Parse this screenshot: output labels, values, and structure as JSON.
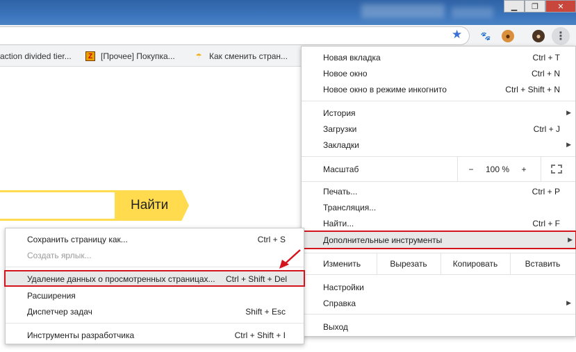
{
  "window": {
    "minimize": "▁",
    "maximize": "❐",
    "close": "✕"
  },
  "bookmarks": [
    {
      "label": "action divided tier..."
    },
    {
      "label": "[Прочее] Покупка...",
      "icon": "z-favicon"
    },
    {
      "label": "Как сменить стран...",
      "icon": "umbrella-favicon"
    }
  ],
  "page": {
    "find_button": "Найти"
  },
  "menu": {
    "new_tab": {
      "label": "Новая вкладка",
      "shortcut": "Ctrl + T"
    },
    "new_window": {
      "label": "Новое окно",
      "shortcut": "Ctrl + N"
    },
    "incognito": {
      "label": "Новое окно в режиме инкогнито",
      "shortcut": "Ctrl + Shift + N"
    },
    "history": {
      "label": "История"
    },
    "downloads": {
      "label": "Загрузки",
      "shortcut": "Ctrl + J"
    },
    "bookmarks": {
      "label": "Закладки"
    },
    "zoom": {
      "label": "Масштаб",
      "minus": "−",
      "value": "100 %",
      "plus": "+"
    },
    "print": {
      "label": "Печать...",
      "shortcut": "Ctrl + P"
    },
    "cast": {
      "label": "Трансляция..."
    },
    "find": {
      "label": "Найти...",
      "shortcut": "Ctrl + F"
    },
    "more_tools": {
      "label": "Дополнительные инструменты"
    },
    "edit": {
      "label": "Изменить",
      "cut": "Вырезать",
      "copy": "Копировать",
      "paste": "Вставить"
    },
    "settings": {
      "label": "Настройки"
    },
    "help": {
      "label": "Справка"
    },
    "exit": {
      "label": "Выход"
    }
  },
  "submenu": {
    "save_page": {
      "label": "Сохранить страницу как...",
      "shortcut": "Ctrl + S"
    },
    "create_shortcut": {
      "label": "Создать ярлык..."
    },
    "clear_data": {
      "label": "Удаление данных о просмотренных страницах...",
      "shortcut": "Ctrl + Shift + Del"
    },
    "extensions": {
      "label": "Расширения"
    },
    "task_manager": {
      "label": "Диспетчер задач",
      "shortcut": "Shift + Esc"
    },
    "dev_tools": {
      "label": "Инструменты разработчика",
      "shortcut": "Ctrl + Shift + I"
    }
  },
  "colors": {
    "highlight_border": "#d3141c",
    "yandex_yellow": "#ffdb4d"
  }
}
